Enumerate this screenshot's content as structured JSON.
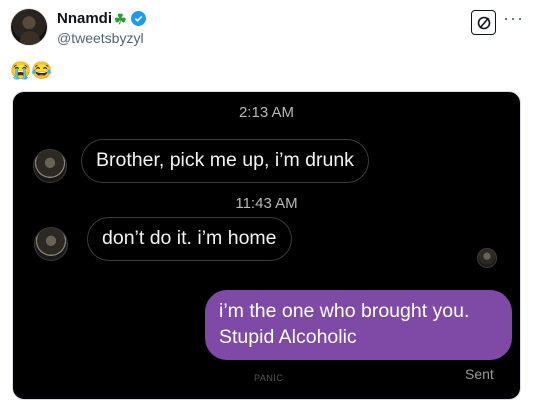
{
  "author": {
    "name": "Nnamdi",
    "badge_emoji": "☘",
    "verified": true,
    "handle": "@tweetsbyzyl"
  },
  "post": {
    "text": "😭😂"
  },
  "actions": {
    "grok_icon": "grok-slash-icon",
    "more_icon": "more-horizontal-icon",
    "more_glyph": "···"
  },
  "chat": {
    "timestamp_1": "2:13 AM",
    "message_1": "Brother, pick me up, i’m drunk",
    "timestamp_2": "11:43 AM",
    "message_2": "don’t do it. i’m home",
    "reply_line_1": "i’m the one who brought you.",
    "reply_line_2": "Stupid Alcoholic",
    "watermark": "PANIC",
    "status": "Sent"
  },
  "colors": {
    "verified_blue": "#1d9bf0",
    "outgoing_bubble": "#7f4aa6",
    "chat_background": "#000000"
  }
}
